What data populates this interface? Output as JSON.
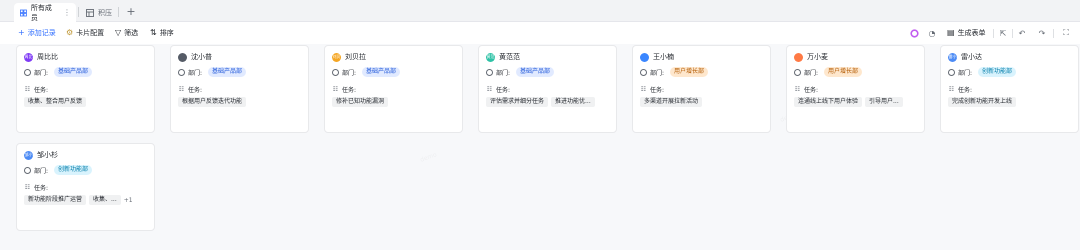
{
  "tabs": [
    {
      "label": "所有成员",
      "menu": "⋮",
      "icon": "grid-icon",
      "active": true
    },
    {
      "label": "积压",
      "icon": "table-icon",
      "active": false
    }
  ],
  "toolbar": {
    "add_record": "添加记录",
    "card_settings": "卡片配置",
    "filter": "筛选",
    "sort": "排序",
    "generate_form": "生成表单"
  },
  "field_labels": {
    "department": "部门:",
    "task": "任务:"
  },
  "colors": {
    "accent": "#3370ff",
    "dept_blue_bg": "#e1eaff",
    "dept_orange_bg": "#fee7cd",
    "dept_cyan_bg": "#d9f3fd"
  },
  "cards": [
    {
      "name": "周比比",
      "avatar": "周比",
      "avatar_color": "#7f3bf5",
      "department": "基础产品部",
      "dept_color": "blue",
      "tasks": [
        "收集、整合用户反馈"
      ],
      "more": ""
    },
    {
      "name": "沈小普",
      "avatar": "",
      "avatar_color": "#555b66",
      "department": "基础产品部",
      "dept_color": "blue",
      "tasks": [
        "根据用户反馈迭代功能"
      ],
      "more": ""
    },
    {
      "name": "刘贝拉",
      "avatar": "刘贝",
      "avatar_color": "#f5a623",
      "department": "基础产品部",
      "dept_color": "blue",
      "tasks": [
        "修补已知功能漏洞"
      ],
      "more": ""
    },
    {
      "name": "黄范范",
      "avatar": "黄范",
      "avatar_color": "#2ec2a6",
      "department": "基础产品部",
      "dept_color": "blue",
      "tasks": [
        "评估需求并细分任务",
        "推进功能优..."
      ],
      "more": ""
    },
    {
      "name": "王小楠",
      "avatar": "",
      "avatar_color": "#3a86ff",
      "department": "用户增长部",
      "dept_color": "orange",
      "tasks": [
        "多渠道开展拉新活动"
      ],
      "more": ""
    },
    {
      "name": "万小麦",
      "avatar": "",
      "avatar_color": "#ff7a45",
      "department": "用户增长部",
      "dept_color": "orange",
      "tasks": [
        "连通线上线下用户体验",
        "引导用户..."
      ],
      "more": ""
    },
    {
      "name": "雷小达",
      "avatar": "雷小",
      "avatar_color": "#4c8bf5",
      "department": "创新功能部",
      "dept_color": "cyan",
      "tasks": [
        "完成创新功能开发上线"
      ],
      "more": ""
    },
    {
      "name": "邹小杉",
      "avatar": "邹小",
      "avatar_color": "#4c8bf5",
      "department": "创新功能部",
      "dept_color": "cyan",
      "tasks": [
        "新功能阶段推广运营",
        "收集、..."
      ],
      "more": "+1"
    }
  ]
}
